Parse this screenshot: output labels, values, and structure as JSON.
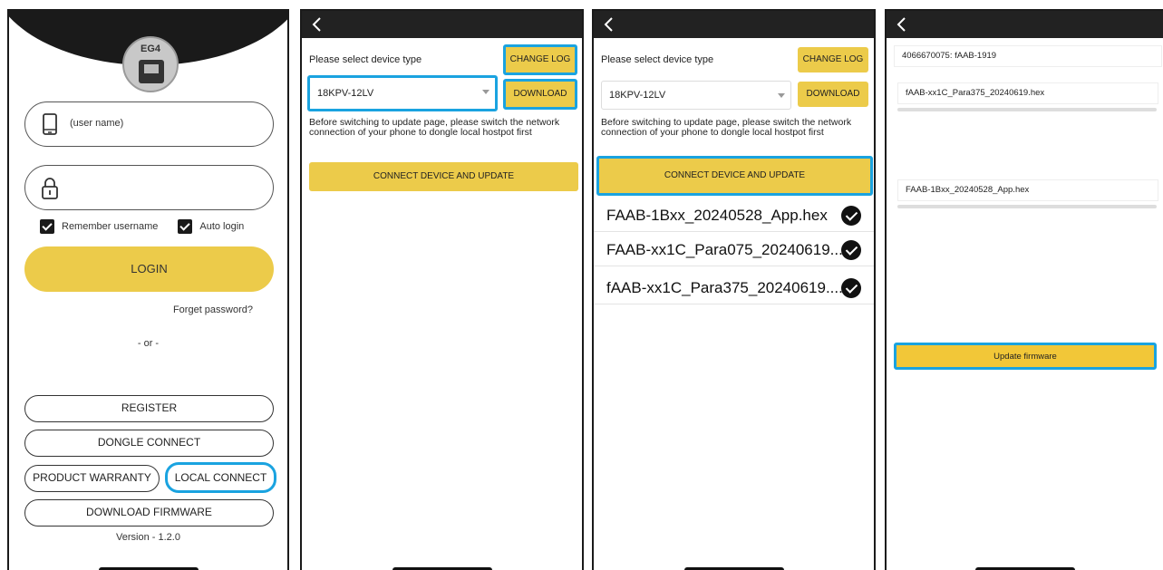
{
  "screen1": {
    "logo_text": "EG4",
    "username_placeholder": "(user name)",
    "remember_label": "Remember username",
    "autologin_label": "Auto login",
    "login_label": "LOGIN",
    "forget_label": "Forget password?",
    "or_label": "- or -",
    "register_label": "REGISTER",
    "dongle_label": "DONGLE CONNECT",
    "warranty_label": "PRODUCT WARRANTY",
    "local_label": "LOCAL CONNECT",
    "download_fw_label": "DOWNLOAD FIRMWARE",
    "version": "Version - 1.2.0"
  },
  "screen2": {
    "select_prompt": "Please select device type",
    "change_log_label": "CHANGE LOG",
    "device_type": "18KPV-12LV",
    "download_label": "DOWNLOAD",
    "note": "Before switching to update page, please switch the network connection of your phone to dongle local hostpot first",
    "connect_label": "CONNECT DEVICE AND UPDATE"
  },
  "screen3": {
    "select_prompt": "Please select device type",
    "change_log_label": "CHANGE LOG",
    "device_type": "18KPV-12LV",
    "download_label": "DOWNLOAD",
    "note": "Before switching to update page, please switch the network connection of your phone to dongle local hostpot first",
    "connect_label": "CONNECT DEVICE AND UPDATE",
    "files": [
      "FAAB-1Bxx_20240528_App.hex",
      "FAAB-xx1C_Para075_20240619....",
      "fAAB-xx1C_Para375_20240619...."
    ]
  },
  "screen4": {
    "device_id": "4066670075: fAAB-1919",
    "file1": "fAAB-xx1C_Para375_20240619.hex",
    "file2": "FAAB-1Bxx_20240528_App.hex",
    "update_label": "Update firmware"
  },
  "colors": {
    "accent_yellow": "#eccb4a",
    "highlight_blue": "#1aa3e0",
    "dark": "#1a1a1a"
  }
}
